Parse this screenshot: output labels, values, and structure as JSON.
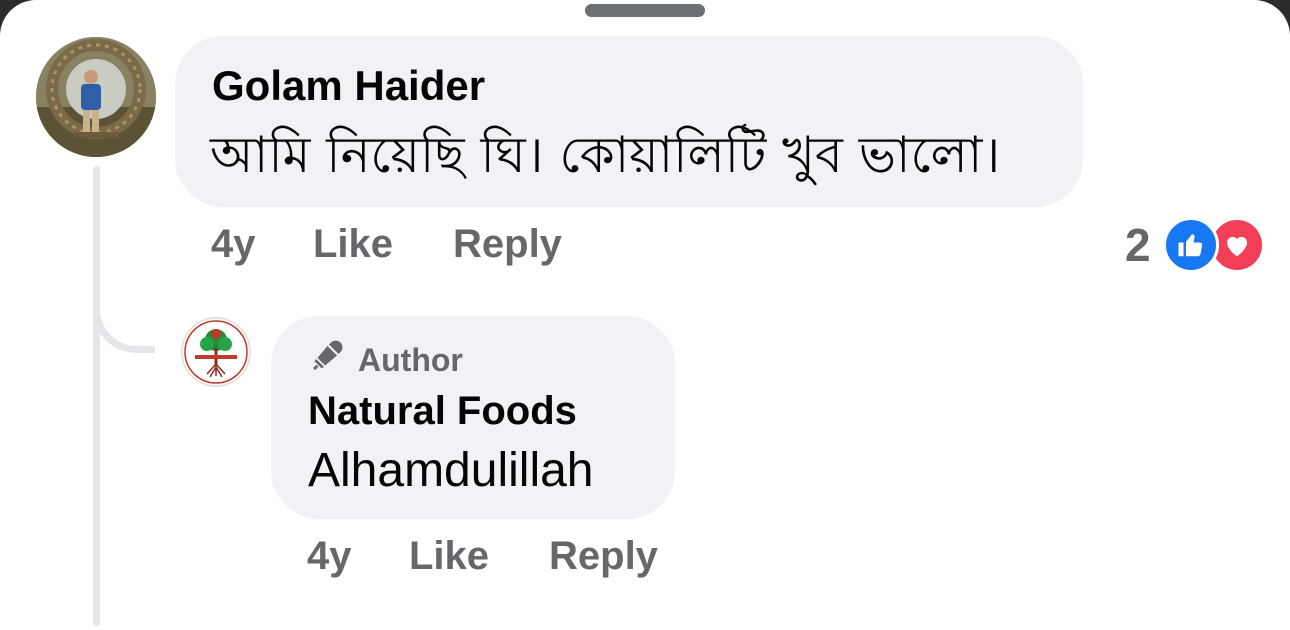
{
  "colors": {
    "bubble": "#f0f2f5",
    "meta_text": "#65676b",
    "primary_text": "#050505",
    "like_blue": "#1877f2",
    "love_red": "#f33e58"
  },
  "comment": {
    "author": "Golam Haider",
    "text": "আমি নিয়েছি ঘি। কোয়ালিটি খুব ভালো।",
    "time": "4y",
    "like_label": "Like",
    "reply_label": "Reply",
    "reactions": {
      "count": "2",
      "icons": [
        "like-icon",
        "love-icon"
      ]
    }
  },
  "reply": {
    "badge_icon": "microphone-icon",
    "badge": "Author",
    "author": "Natural Foods",
    "text": "Alhamdulillah",
    "time": "4y",
    "like_label": "Like",
    "reply_label": "Reply"
  }
}
